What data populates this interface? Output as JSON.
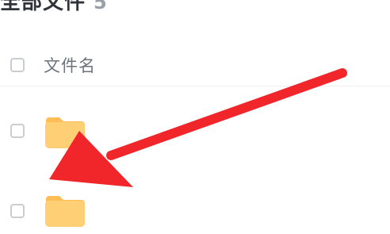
{
  "header": {
    "title": "全部文件",
    "count": "5"
  },
  "list": {
    "column_name_label": "文件名",
    "rows": [
      {
        "icon": "folder-icon"
      },
      {
        "icon": "folder-icon"
      }
    ]
  },
  "annotation": {
    "arrow_color": "#f0262b"
  },
  "colors": {
    "folder": "#ffcf75",
    "folder_tab": "#ffbe55"
  }
}
